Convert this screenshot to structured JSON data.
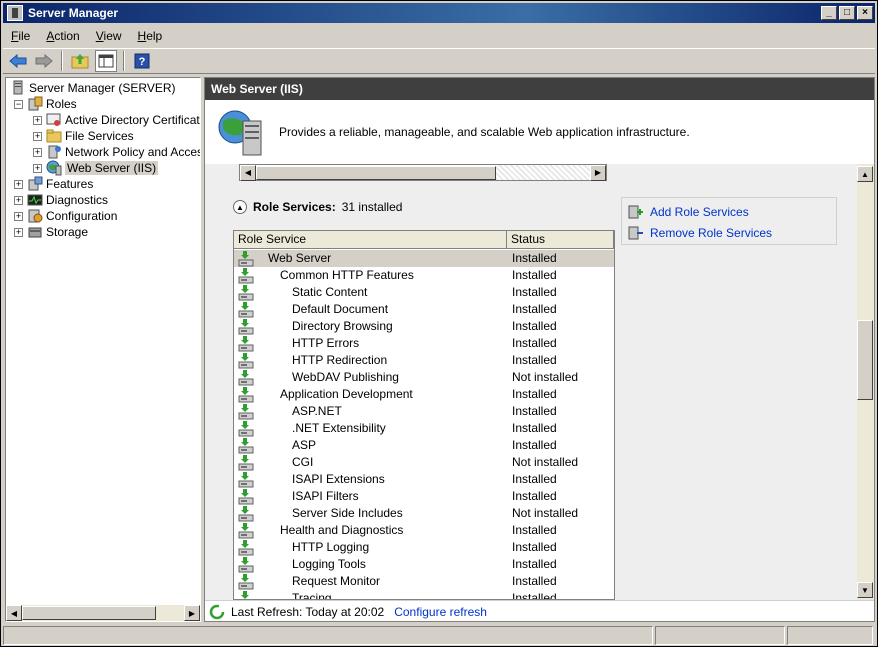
{
  "window": {
    "title": "Server Manager"
  },
  "menu": [
    {
      "key": "F",
      "rest": "ile"
    },
    {
      "key": "A",
      "rest": "ction"
    },
    {
      "key": "V",
      "rest": "iew"
    },
    {
      "key": "H",
      "rest": "elp"
    }
  ],
  "toolbar": {
    "icons": [
      "back-arrow-icon",
      "forward-arrow-icon",
      "up-folder-icon",
      "show-hide-console-tree-icon",
      "help-icon"
    ]
  },
  "tree": {
    "root": "Server Manager (SERVER)",
    "roles": "Roles",
    "role_items": [
      "Active Directory Certificate",
      "File Services",
      "Network Policy and Access",
      "Web Server (IIS)"
    ],
    "features": "Features",
    "diagnostics": "Diagnostics",
    "configuration": "Configuration",
    "storage": "Storage",
    "expander_minus": "−",
    "expander_plus": "+"
  },
  "pane": {
    "header": "Web Server (IIS)",
    "description": "Provides a reliable, manageable, and scalable Web application infrastructure."
  },
  "role_services": {
    "title": "Role Services:",
    "count": "31 installed",
    "columns": [
      "Role Service",
      "Status"
    ],
    "rows": [
      {
        "name": "Web Server",
        "level": 0,
        "status": "Installed"
      },
      {
        "name": "Common HTTP Features",
        "level": 1,
        "status": "Installed"
      },
      {
        "name": "Static Content",
        "level": 2,
        "status": "Installed"
      },
      {
        "name": "Default Document",
        "level": 2,
        "status": "Installed"
      },
      {
        "name": "Directory Browsing",
        "level": 2,
        "status": "Installed"
      },
      {
        "name": "HTTP Errors",
        "level": 2,
        "status": "Installed"
      },
      {
        "name": "HTTP Redirection",
        "level": 2,
        "status": "Installed"
      },
      {
        "name": "WebDAV Publishing",
        "level": 2,
        "status": "Not installed"
      },
      {
        "name": "Application Development",
        "level": 1,
        "status": "Installed"
      },
      {
        "name": "ASP.NET",
        "level": 2,
        "status": "Installed"
      },
      {
        "name": ".NET Extensibility",
        "level": 2,
        "status": "Installed"
      },
      {
        "name": "ASP",
        "level": 2,
        "status": "Installed"
      },
      {
        "name": "CGI",
        "level": 2,
        "status": "Not installed"
      },
      {
        "name": "ISAPI Extensions",
        "level": 2,
        "status": "Installed"
      },
      {
        "name": "ISAPI Filters",
        "level": 2,
        "status": "Installed"
      },
      {
        "name": "Server Side Includes",
        "level": 2,
        "status": "Not installed"
      },
      {
        "name": "Health and Diagnostics",
        "level": 1,
        "status": "Installed"
      },
      {
        "name": "HTTP Logging",
        "level": 2,
        "status": "Installed"
      },
      {
        "name": "Logging Tools",
        "level": 2,
        "status": "Installed"
      },
      {
        "name": "Request Monitor",
        "level": 2,
        "status": "Installed"
      },
      {
        "name": "Tracing",
        "level": 2,
        "status": "Installed"
      }
    ]
  },
  "actions": {
    "add": "Add Role Services",
    "remove": "Remove Role Services"
  },
  "footer": {
    "last_refresh": "Last Refresh: Today at 20:02",
    "configure": "Configure refresh"
  },
  "colors": {
    "title_bar": "#0a246a",
    "link": "#0033cc",
    "pane_header": "#3f3f3f",
    "installed_arrow": "#2e9e2e"
  }
}
